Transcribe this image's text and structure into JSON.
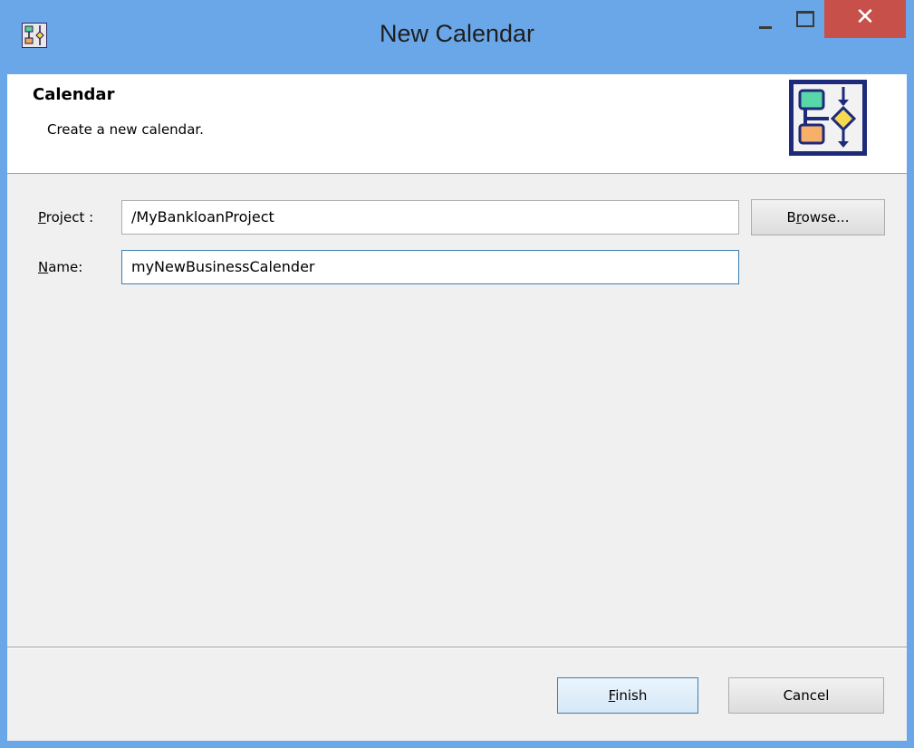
{
  "window": {
    "title": "New Calendar",
    "close_glyph": "✕"
  },
  "banner": {
    "title": "Calendar",
    "subtitle": "Create a new calendar.",
    "icon": "workflow-diagram-icon"
  },
  "form": {
    "project_label_mnemonic": "P",
    "project_label_rest": "roject :",
    "project_value": "/MyBankloanProject",
    "name_label_mnemonic": "N",
    "name_label_rest": "ame:",
    "name_value": "myNewBusinessCalender",
    "browse_label_pre": "B",
    "browse_label_mnemonic": "r",
    "browse_label_rest": "owse..."
  },
  "footer": {
    "finish_mnemonic": "F",
    "finish_rest": "inish",
    "cancel_label": "Cancel"
  },
  "colors": {
    "titlebar": "#6aa7e9",
    "close_button": "#c7504a",
    "client_bg": "#f0f0f0",
    "focus_border": "#3c7fb1"
  }
}
